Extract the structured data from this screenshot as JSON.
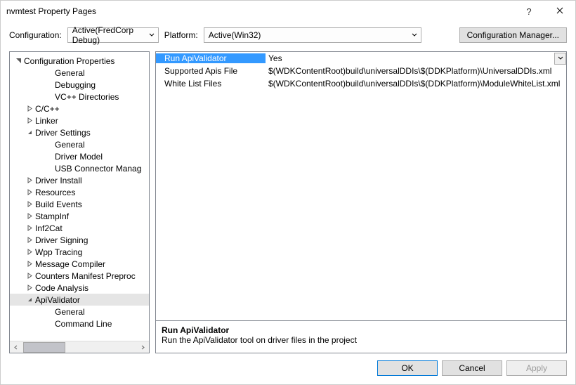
{
  "window": {
    "title": "nvmtest Property Pages"
  },
  "topbar": {
    "config_label": "Configuration:",
    "config_value": "Active(FredCorp Debug)",
    "platform_label": "Platform:",
    "platform_value": "Active(Win32)",
    "config_mgr": "Configuration Manager..."
  },
  "tree": {
    "root": "Configuration Properties",
    "items": [
      {
        "label": "General",
        "glyph": "none",
        "indent": 2
      },
      {
        "label": "Debugging",
        "glyph": "none",
        "indent": 2
      },
      {
        "label": "VC++ Directories",
        "glyph": "none",
        "indent": 2
      },
      {
        "label": "C/C++",
        "glyph": "closed",
        "indent": 1
      },
      {
        "label": "Linker",
        "glyph": "closed",
        "indent": 1
      },
      {
        "label": "Driver Settings",
        "glyph": "open",
        "indent": 1
      },
      {
        "label": "General",
        "glyph": "none",
        "indent": 2
      },
      {
        "label": "Driver Model",
        "glyph": "none",
        "indent": 2
      },
      {
        "label": "USB Connector Manag",
        "glyph": "none",
        "indent": 2
      },
      {
        "label": "Driver Install",
        "glyph": "closed",
        "indent": 1
      },
      {
        "label": "Resources",
        "glyph": "closed",
        "indent": 1
      },
      {
        "label": "Build Events",
        "glyph": "closed",
        "indent": 1
      },
      {
        "label": "StampInf",
        "glyph": "closed",
        "indent": 1
      },
      {
        "label": "Inf2Cat",
        "glyph": "closed",
        "indent": 1
      },
      {
        "label": "Driver Signing",
        "glyph": "closed",
        "indent": 1
      },
      {
        "label": "Wpp Tracing",
        "glyph": "closed",
        "indent": 1
      },
      {
        "label": "Message Compiler",
        "glyph": "closed",
        "indent": 1
      },
      {
        "label": "Counters Manifest Preproc",
        "glyph": "closed",
        "indent": 1
      },
      {
        "label": "Code Analysis",
        "glyph": "closed",
        "indent": 1
      },
      {
        "label": "ApiValidator",
        "glyph": "open",
        "indent": 1,
        "selected": true
      },
      {
        "label": "General",
        "glyph": "none",
        "indent": 2
      },
      {
        "label": "Command Line",
        "glyph": "none",
        "indent": 2
      }
    ]
  },
  "grid": {
    "rows": [
      {
        "name": "Run ApiValidator",
        "value": "Yes",
        "selected": true
      },
      {
        "name": "Supported Apis File",
        "value": "$(WDKContentRoot)build\\universalDDIs\\$(DDKPlatform)\\UniversalDDIs.xml"
      },
      {
        "name": "White List Files",
        "value": "$(WDKContentRoot)build\\universalDDIs\\$(DDKPlatform)\\ModuleWhiteList.xml"
      }
    ]
  },
  "description": {
    "title": "Run ApiValidator",
    "text": "Run the ApiValidator tool on driver files in the project"
  },
  "footer": {
    "ok": "OK",
    "cancel": "Cancel",
    "apply": "Apply"
  }
}
